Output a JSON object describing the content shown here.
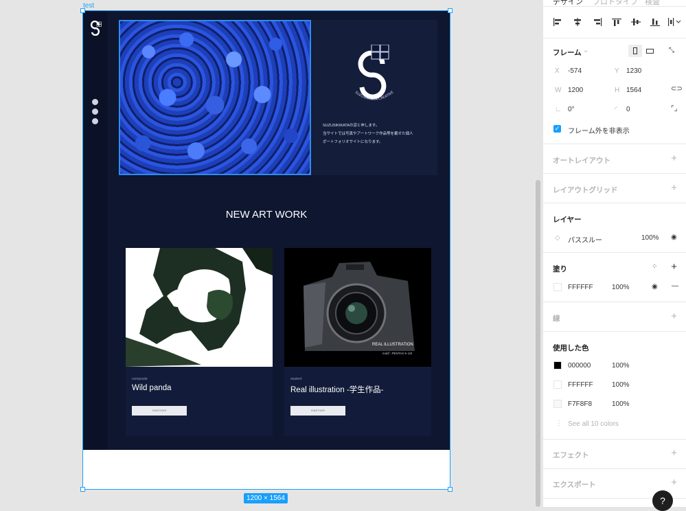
{
  "canvas": {
    "frame_name": "test",
    "frame_size_badge": "1200 × 1564"
  },
  "site": {
    "logo_text": "SUZUSIKIKATA-CREATIVE",
    "intro_lines": [
      "SUZUSIKIKATAの涼と申します。",
      "当サイトでは写真やアートワーク作品等を載せた個人",
      "ポートフォリオサイトになります。"
    ],
    "social_icons": [
      "facebook-icon",
      "instagram-icon",
      "twitter-icon"
    ],
    "section_title": "NEW ART WORK",
    "cards": [
      {
        "category": "composite",
        "title": "Wild panda",
        "button": "read more"
      },
      {
        "category": "student",
        "title": "Real illustration -学生作品-",
        "button": "read more",
        "image_caption": "REAL ILLUSTRATION",
        "image_subcaption": "motif : PENTAX K-1III"
      }
    ]
  },
  "panel": {
    "tabs": [
      "デザイン",
      "プロトタイプ",
      "検査"
    ],
    "frame": {
      "title": "フレーム",
      "x_label": "X",
      "x": "-574",
      "y_label": "Y",
      "y": "1230",
      "w_label": "W",
      "w": "1200",
      "h_label": "H",
      "h": "1564",
      "rotation": "0°",
      "radius": "0",
      "clip_label": "フレーム外を非表示"
    },
    "auto_layout": "オートレイアウト",
    "layout_grid": "レイアウトグリッド",
    "layer": {
      "title": "レイヤー",
      "blend": "パススルー",
      "opacity": "100%"
    },
    "fill": {
      "title": "塗り",
      "hex": "FFFFFF",
      "opacity": "100%"
    },
    "stroke": "線",
    "used_colors": {
      "title": "使用した色",
      "items": [
        {
          "hex": "000000",
          "opacity": "100%",
          "color": "#000000"
        },
        {
          "hex": "FFFFFF",
          "opacity": "100%",
          "color": "#FFFFFF"
        },
        {
          "hex": "F7F8F8",
          "opacity": "100%",
          "color": "#F7F8F8"
        }
      ],
      "see_all": "See all 10 colors"
    },
    "effects": "エフェクト",
    "export": "エクスポート",
    "help": "?"
  }
}
